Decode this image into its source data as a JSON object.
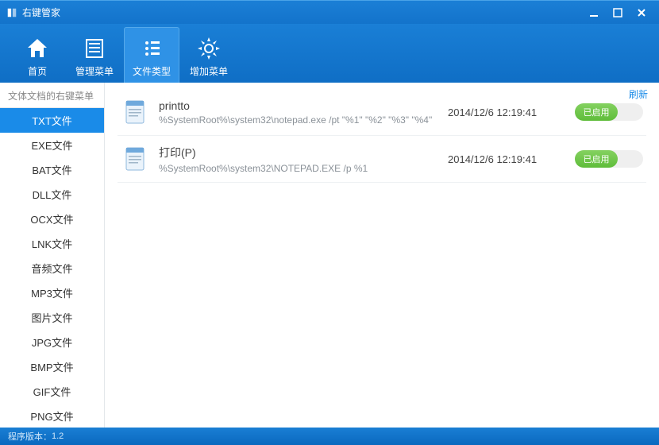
{
  "window": {
    "title": "右键管家"
  },
  "top_nav": [
    {
      "key": "home",
      "label": "首页"
    },
    {
      "key": "manage",
      "label": "管理菜单"
    },
    {
      "key": "filetype",
      "label": "文件类型"
    },
    {
      "key": "add",
      "label": "增加菜单"
    }
  ],
  "sidebar": {
    "title": "文体文档的右键菜单",
    "groups": [
      [
        "TXT文件",
        "EXE文件",
        "BAT文件",
        "DLL文件",
        "OCX文件",
        "LNK文件"
      ],
      [
        "音频文件",
        "MP3文件"
      ],
      [
        "图片文件",
        "JPG文件",
        "BMP文件",
        "GIF文件",
        "PNG文件"
      ]
    ],
    "selected": "TXT文件"
  },
  "refresh_label": "刷新",
  "entries": [
    {
      "name": "printto",
      "path": "%SystemRoot%\\system32\\notepad.exe /pt \"%1\" \"%2\" \"%3\" \"%4\"",
      "timestamp": "2014/12/6 12:19:41",
      "toggle_label": "已启用"
    },
    {
      "name": "打印(P)",
      "path": "%SystemRoot%\\system32\\NOTEPAD.EXE /p %1",
      "timestamp": "2014/12/6 12:19:41",
      "toggle_label": "已启用"
    }
  ],
  "statusbar": {
    "version_label": "程序版本：",
    "version": "1.2"
  }
}
